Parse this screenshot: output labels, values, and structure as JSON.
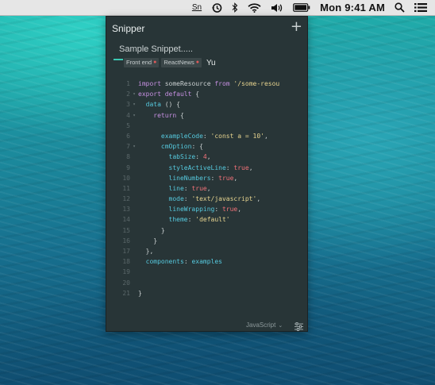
{
  "menubar": {
    "sn_label": "Sn",
    "clock": "Mon 9:41 AM",
    "icons": [
      "snippet-menubar-icon",
      "history-icon",
      "bluetooth-icon",
      "wifi-icon",
      "volume-icon",
      "battery-icon",
      "search-icon",
      "list-icon"
    ]
  },
  "app": {
    "title": "Snipper",
    "add_label": "+",
    "snippet_title": "Sample Snippet.....",
    "tags": [
      {
        "label": "Front end",
        "remove": "●"
      },
      {
        "label": "ReactNews",
        "remove": "●"
      }
    ],
    "tag_input_value": "Yu",
    "footer": {
      "language": "JavaScript",
      "caret": "⌄"
    }
  },
  "code_lines": [
    {
      "n": "1",
      "fold": "",
      "tokens": [
        [
          "kw",
          "import"
        ],
        [
          "pl",
          " someResource "
        ],
        [
          "kw",
          "from"
        ],
        [
          "str",
          " '/some-resou"
        ]
      ]
    },
    {
      "n": "2",
      "fold": "▾",
      "tokens": [
        [
          "kw",
          "export default"
        ],
        [
          "pl",
          " {"
        ]
      ]
    },
    {
      "n": "3",
      "fold": "▾",
      "tokens": [
        [
          "pl",
          "  "
        ],
        [
          "prop",
          "data"
        ],
        [
          "pl",
          " () {"
        ]
      ]
    },
    {
      "n": "4",
      "fold": "▾",
      "tokens": [
        [
          "pl",
          "    "
        ],
        [
          "kw",
          "return"
        ],
        [
          "pl",
          " {"
        ]
      ]
    },
    {
      "n": "5",
      "fold": "",
      "tokens": []
    },
    {
      "n": "6",
      "fold": "",
      "tokens": [
        [
          "pl",
          "      "
        ],
        [
          "prop",
          "exampleCode"
        ],
        [
          "pl",
          ": "
        ],
        [
          "str",
          "'const a = 10'"
        ],
        [
          "pl",
          ","
        ]
      ]
    },
    {
      "n": "7",
      "fold": "▾",
      "tokens": [
        [
          "pl",
          "      "
        ],
        [
          "prop",
          "cmOption"
        ],
        [
          "pl",
          ": {"
        ]
      ]
    },
    {
      "n": "8",
      "fold": "",
      "tokens": [
        [
          "pl",
          "        "
        ],
        [
          "prop",
          "tabSize"
        ],
        [
          "pl",
          ": "
        ],
        [
          "num",
          "4"
        ],
        [
          "pl",
          ","
        ]
      ]
    },
    {
      "n": "9",
      "fold": "",
      "tokens": [
        [
          "pl",
          "        "
        ],
        [
          "prop",
          "styleActiveLine"
        ],
        [
          "pl",
          ": "
        ],
        [
          "tru",
          "true"
        ],
        [
          "pl",
          ","
        ]
      ]
    },
    {
      "n": "10",
      "fold": "",
      "tokens": [
        [
          "pl",
          "        "
        ],
        [
          "prop",
          "lineNumbers"
        ],
        [
          "pl",
          ": "
        ],
        [
          "tru",
          "true"
        ],
        [
          "pl",
          ","
        ]
      ]
    },
    {
      "n": "11",
      "fold": "",
      "tokens": [
        [
          "pl",
          "        "
        ],
        [
          "prop",
          "line"
        ],
        [
          "pl",
          ": "
        ],
        [
          "tru",
          "true"
        ],
        [
          "pl",
          ","
        ]
      ]
    },
    {
      "n": "12",
      "fold": "",
      "tokens": [
        [
          "pl",
          "        "
        ],
        [
          "prop",
          "mode"
        ],
        [
          "pl",
          ": "
        ],
        [
          "str",
          "'text/javascript'"
        ],
        [
          "pl",
          ","
        ]
      ]
    },
    {
      "n": "13",
      "fold": "",
      "tokens": [
        [
          "pl",
          "        "
        ],
        [
          "prop",
          "lineWrapping"
        ],
        [
          "pl",
          ": "
        ],
        [
          "tru",
          "true"
        ],
        [
          "pl",
          ","
        ]
      ]
    },
    {
      "n": "14",
      "fold": "",
      "tokens": [
        [
          "pl",
          "        "
        ],
        [
          "prop",
          "theme"
        ],
        [
          "pl",
          ": "
        ],
        [
          "str",
          "'default'"
        ]
      ]
    },
    {
      "n": "15",
      "fold": "",
      "tokens": [
        [
          "pl",
          "      }"
        ]
      ]
    },
    {
      "n": "16",
      "fold": "",
      "tokens": [
        [
          "pl",
          "    }"
        ]
      ]
    },
    {
      "n": "17",
      "fold": "",
      "tokens": [
        [
          "pl",
          "  },"
        ]
      ]
    },
    {
      "n": "18",
      "fold": "",
      "tokens": [
        [
          "pl",
          "  "
        ],
        [
          "prop",
          "components"
        ],
        [
          "pl",
          ": "
        ],
        [
          "ref",
          "examples"
        ]
      ]
    },
    {
      "n": "19",
      "fold": "",
      "tokens": []
    },
    {
      "n": "20",
      "fold": "",
      "tokens": []
    },
    {
      "n": "21",
      "fold": "",
      "tokens": [
        [
          "pl",
          "}"
        ]
      ]
    }
  ],
  "colors": {
    "window_bg": "#283537",
    "accent": "#3cc9b3",
    "keyword": "#c58fe0",
    "string": "#e7d48f",
    "property": "#56c9de",
    "boolean": "#f07178"
  }
}
